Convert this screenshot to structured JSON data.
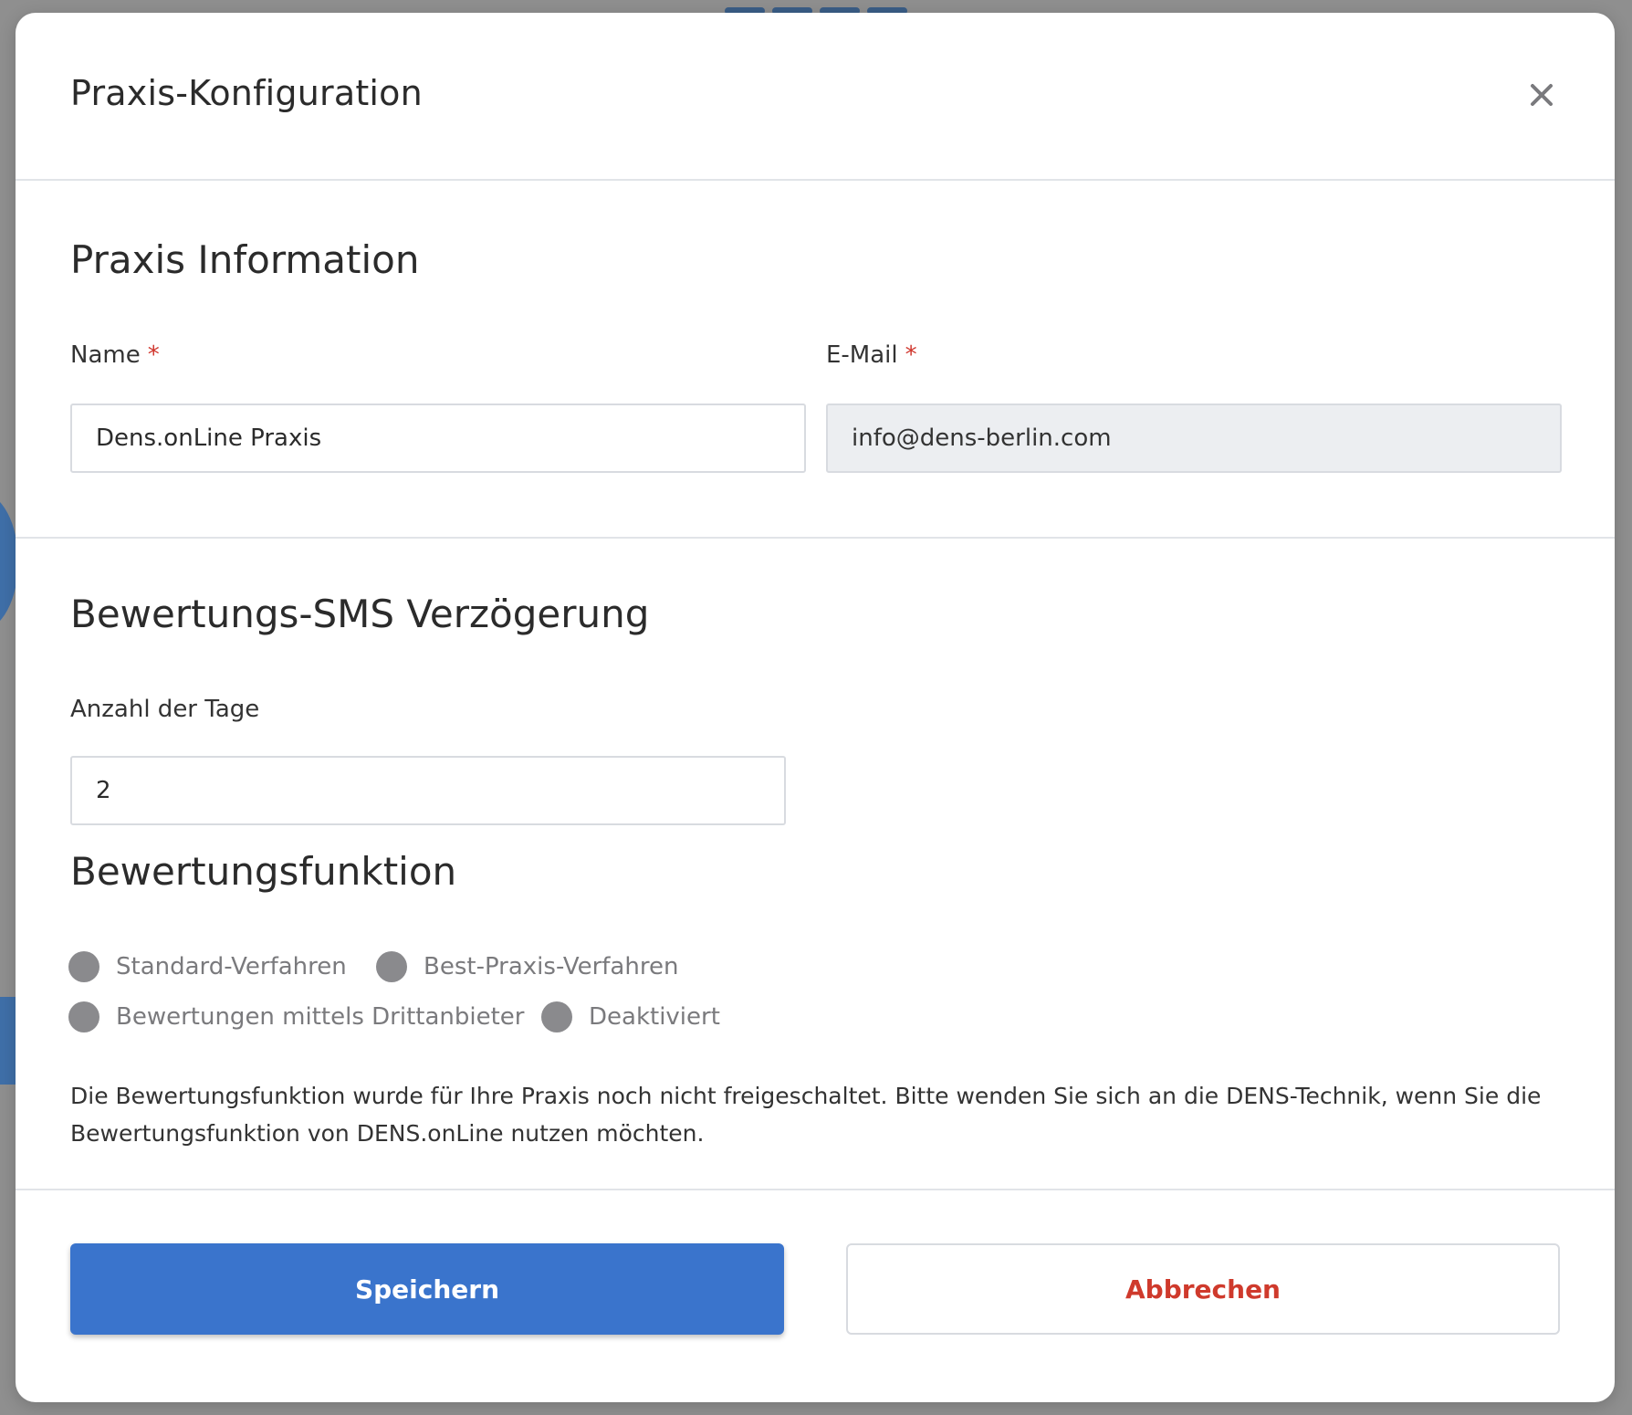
{
  "modal": {
    "title": "Praxis-Konfiguration"
  },
  "info_section": {
    "heading": "Praxis Information",
    "name_label": "Name",
    "name_value": "Dens.onLine Praxis",
    "email_label": "E-Mail",
    "email_value": "info@dens-berlin.com",
    "required_mark": "*"
  },
  "sms_section": {
    "heading": "Bewertungs-SMS Verzögerung",
    "days_label": "Anzahl der Tage",
    "days_value": "2"
  },
  "rating_section": {
    "heading": "Bewertungsfunktion",
    "options": [
      {
        "label": "Standard-Verfahren"
      },
      {
        "label": "Best-Praxis-Verfahren"
      },
      {
        "label": "Bewertungen mittels Drittanbieter"
      },
      {
        "label": "Deaktiviert"
      }
    ],
    "notice": "Die Bewertungsfunktion wurde für Ihre Praxis noch nicht freigeschaltet. Bitte wenden Sie sich an die DENS-Technik, wenn Sie die Bewertungsfunktion von DENS.onLine nutzen möchten."
  },
  "footer": {
    "save_label": "Speichern",
    "cancel_label": "Abbrechen"
  },
  "colors": {
    "primary": "#3a74cc",
    "danger": "#cf3a2c",
    "required": "#d0362d",
    "radio_disabled": "#8a8a8d"
  }
}
